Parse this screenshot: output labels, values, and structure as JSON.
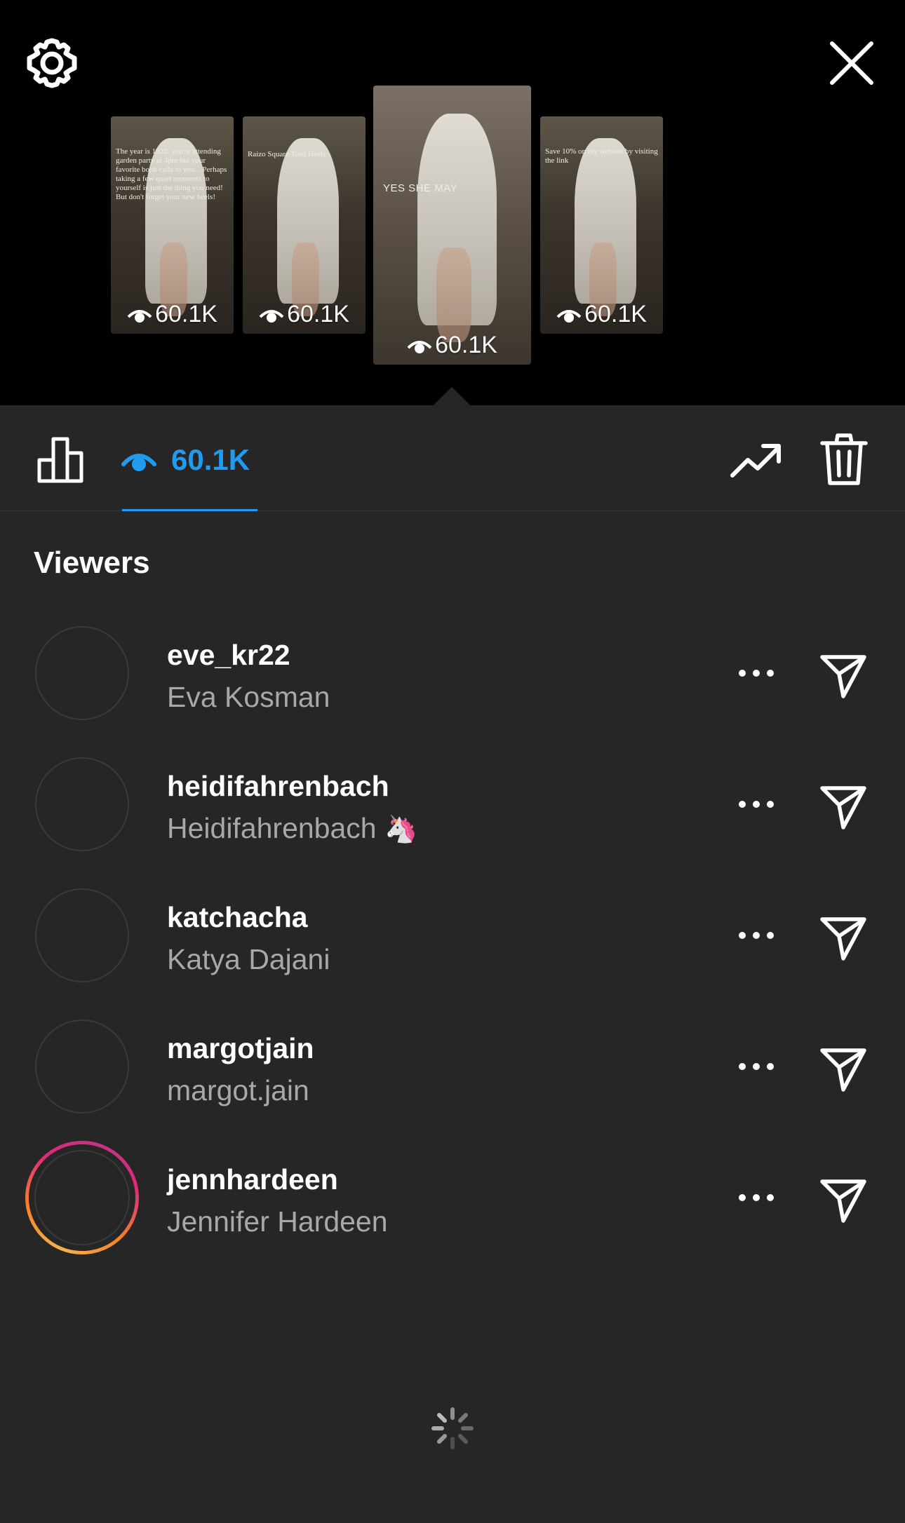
{
  "header": {
    "settings_icon": "gear-icon",
    "close_icon": "close-icon"
  },
  "stories": [
    {
      "views": "60.1K",
      "caption": "The year is 1922, you're attending garden party at 4pm but your favorite book calls to you... Perhaps taking a few quiet moments to yourself is just the thing you need! But don't forget your new heels!"
    },
    {
      "views": "60.1K",
      "caption": "Raizo Square Toed Heels"
    },
    {
      "views": "60.1K",
      "caption": "YES SHE MAY",
      "selected": true
    },
    {
      "views": "60.1K",
      "caption": "Save 10% on my website by visiting the link"
    }
  ],
  "stats_bar": {
    "views_count": "60.1K",
    "insights_icon": "bar-chart-icon",
    "views_icon": "eye-icon",
    "promote_icon": "trending-up-icon",
    "delete_icon": "trash-icon",
    "active_color": "#1f9bf0"
  },
  "viewers_title": "Viewers",
  "viewers": [
    {
      "username": "eve_kr22",
      "name": "Eva Kosman",
      "emoji": "",
      "has_story": false
    },
    {
      "username": "heidifahrenbach",
      "name": "Heidifahrenbach",
      "emoji": "🦄",
      "has_story": false
    },
    {
      "username": "katchacha",
      "name": "Katya Dajani",
      "emoji": "",
      "has_story": false
    },
    {
      "username": "margotjain",
      "name": "margot.jain",
      "emoji": "",
      "has_story": false
    },
    {
      "username": "jennhardeen",
      "name": "Jennifer Hardeen",
      "emoji": "",
      "has_story": true
    }
  ]
}
